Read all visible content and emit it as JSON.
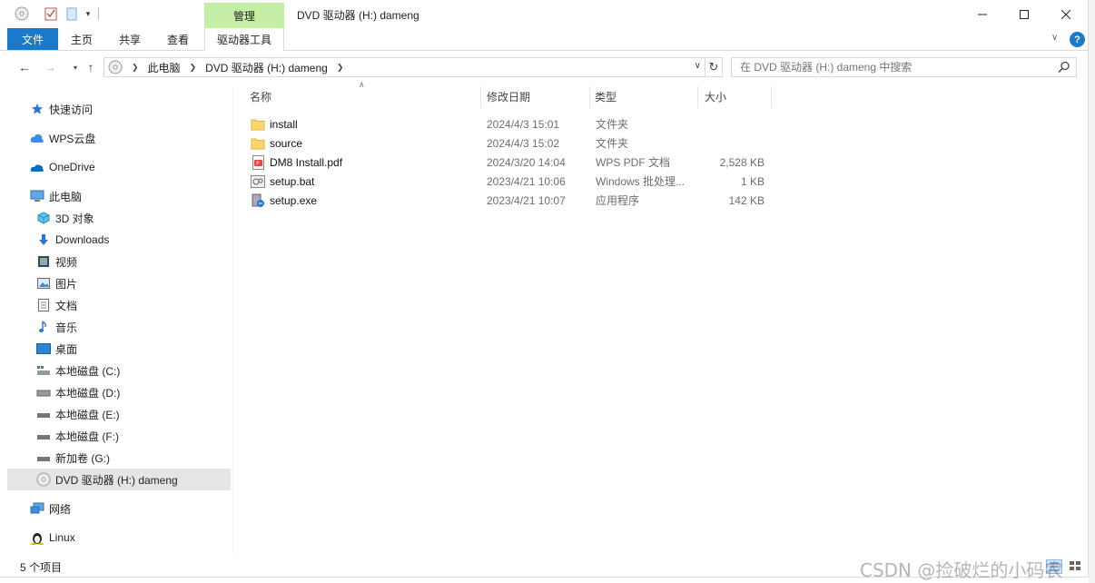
{
  "titlebar": {
    "context_tab": "管理",
    "title": "DVD 驱动器 (H:) dameng"
  },
  "ribbon": {
    "tabs": [
      "文件",
      "主页",
      "共享",
      "查看",
      "驱动器工具"
    ],
    "help": "?"
  },
  "address": {
    "crumbs": [
      "此电脑",
      "DVD 驱动器 (H:) dameng"
    ]
  },
  "search": {
    "placeholder": "在 DVD 驱动器 (H:) dameng 中搜索"
  },
  "nav": {
    "items": [
      {
        "label": "快速访问",
        "icon": "star-icon"
      },
      {
        "label": "WPS云盘",
        "icon": "cloud-icon"
      },
      {
        "label": "OneDrive",
        "icon": "onedrive-icon"
      },
      {
        "label": "此电脑",
        "icon": "computer-icon"
      },
      {
        "label": "3D 对象",
        "icon": "cube-icon"
      },
      {
        "label": "Downloads",
        "icon": "download-icon"
      },
      {
        "label": "视频",
        "icon": "video-icon"
      },
      {
        "label": "图片",
        "icon": "picture-icon"
      },
      {
        "label": "文档",
        "icon": "document-icon"
      },
      {
        "label": "音乐",
        "icon": "music-icon"
      },
      {
        "label": "桌面",
        "icon": "desktop-icon"
      },
      {
        "label": "本地磁盘 (C:)",
        "icon": "drive-icon"
      },
      {
        "label": "本地磁盘 (D:)",
        "icon": "drive-icon"
      },
      {
        "label": "本地磁盘 (E:)",
        "icon": "drive-icon"
      },
      {
        "label": "本地磁盘 (F:)",
        "icon": "drive-icon"
      },
      {
        "label": "新加卷 (G:)",
        "icon": "drive-icon"
      },
      {
        "label": "DVD 驱动器 (H:) dameng",
        "icon": "dvd-icon"
      },
      {
        "label": "网络",
        "icon": "network-icon"
      },
      {
        "label": "Linux",
        "icon": "linux-icon"
      }
    ]
  },
  "files": {
    "columns": [
      "名称",
      "修改日期",
      "类型",
      "大小"
    ],
    "rows": [
      {
        "name": "install",
        "date": "2024/4/3 15:01",
        "type": "文件夹",
        "size": "",
        "icon": "folder-icon"
      },
      {
        "name": "source",
        "date": "2024/4/3 15:02",
        "type": "文件夹",
        "size": "",
        "icon": "folder-icon"
      },
      {
        "name": "DM8 Install.pdf",
        "date": "2024/3/20 14:04",
        "type": "WPS PDF 文档",
        "size": "2,528 KB",
        "icon": "pdf-icon"
      },
      {
        "name": "setup.bat",
        "date": "2023/4/21 10:06",
        "type": "Windows 批处理...",
        "size": "1 KB",
        "icon": "batch-icon"
      },
      {
        "name": "setup.exe",
        "date": "2023/4/21 10:07",
        "type": "应用程序",
        "size": "142 KB",
        "icon": "exe-icon"
      }
    ]
  },
  "status": {
    "count": "5 个项目"
  },
  "watermark": "CSDN @捡破烂的小码农",
  "colors": {
    "accent": "#1979ca",
    "context_tab": "#c6efa6",
    "selected": "#e5e5e5"
  }
}
